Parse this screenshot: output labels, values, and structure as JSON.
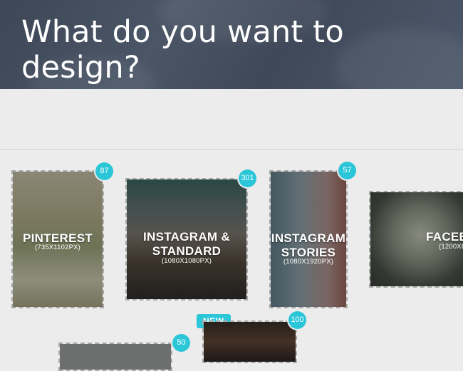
{
  "header": {
    "title": "What do you want to design?"
  },
  "templates": [
    {
      "name": "PINTEREST",
      "size": "(735X1102PX)",
      "count": "87"
    },
    {
      "name": "INSTAGRAM & STANDARD",
      "size": "(1080X1080PX)",
      "count": "301"
    },
    {
      "name": "INSTAGRAM STORIES",
      "size": "(1080X1920PX)",
      "count": "57"
    },
    {
      "name": "FACEB",
      "size": "(1200X6",
      "count": ""
    }
  ],
  "second_row": {
    "new_label": "NEW",
    "badge_left": "50",
    "badge_right": "100"
  },
  "colors": {
    "accent": "#2bc6d8",
    "hero_bg": "#424c5c",
    "page_bg": "#ececec"
  }
}
